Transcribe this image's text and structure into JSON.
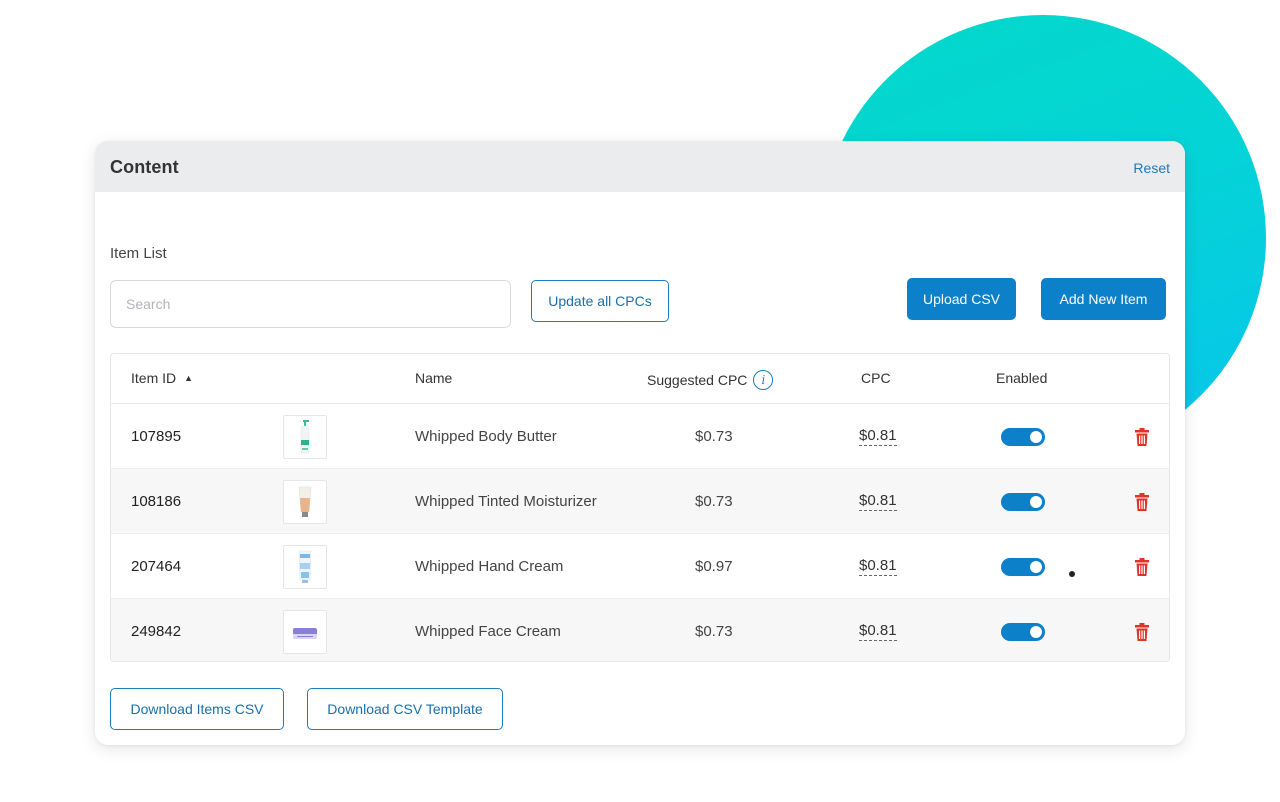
{
  "card": {
    "title": "Content",
    "reset_label": "Reset"
  },
  "item_list": {
    "label": "Item List",
    "search_placeholder": "Search",
    "search_value": "",
    "update_all_label": "Update all CPCs",
    "upload_csv_label": "Upload CSV",
    "add_item_label": "Add New Item"
  },
  "table": {
    "headers": {
      "item_id": "Item ID",
      "name": "Name",
      "suggested_cpc": "Suggested CPC",
      "cpc": "CPC",
      "enabled": "Enabled"
    },
    "sort": {
      "column": "item_id",
      "direction": "ascending",
      "icon": "sort-up-icon"
    },
    "rows": [
      {
        "id": "107895",
        "name": "Whipped Body Butter",
        "suggested_cpc": "$0.73",
        "cpc": "$0.81",
        "enabled": true,
        "thumb": "pump-bottle"
      },
      {
        "id": "108186",
        "name": "Whipped Tinted Moisturizer",
        "suggested_cpc": "$0.73",
        "cpc": "$0.81",
        "enabled": true,
        "thumb": "tan-tube"
      },
      {
        "id": "207464",
        "name": "Whipped Hand Cream",
        "suggested_cpc": "$0.97",
        "cpc": "$0.81",
        "enabled": true,
        "thumb": "blue-tube"
      },
      {
        "id": "249842",
        "name": "Whipped Face Cream",
        "suggested_cpc": "$0.73",
        "cpc": "$0.81",
        "enabled": true,
        "thumb": "purple-jar"
      }
    ]
  },
  "footer": {
    "download_items_label": "Download Items CSV",
    "download_template_label": "Download CSV Template"
  },
  "colors": {
    "accent": "#0c80c8",
    "delete": "#e0342b",
    "decor_circle_start": "#03d8c9",
    "decor_circle_end": "#08c4ec"
  }
}
